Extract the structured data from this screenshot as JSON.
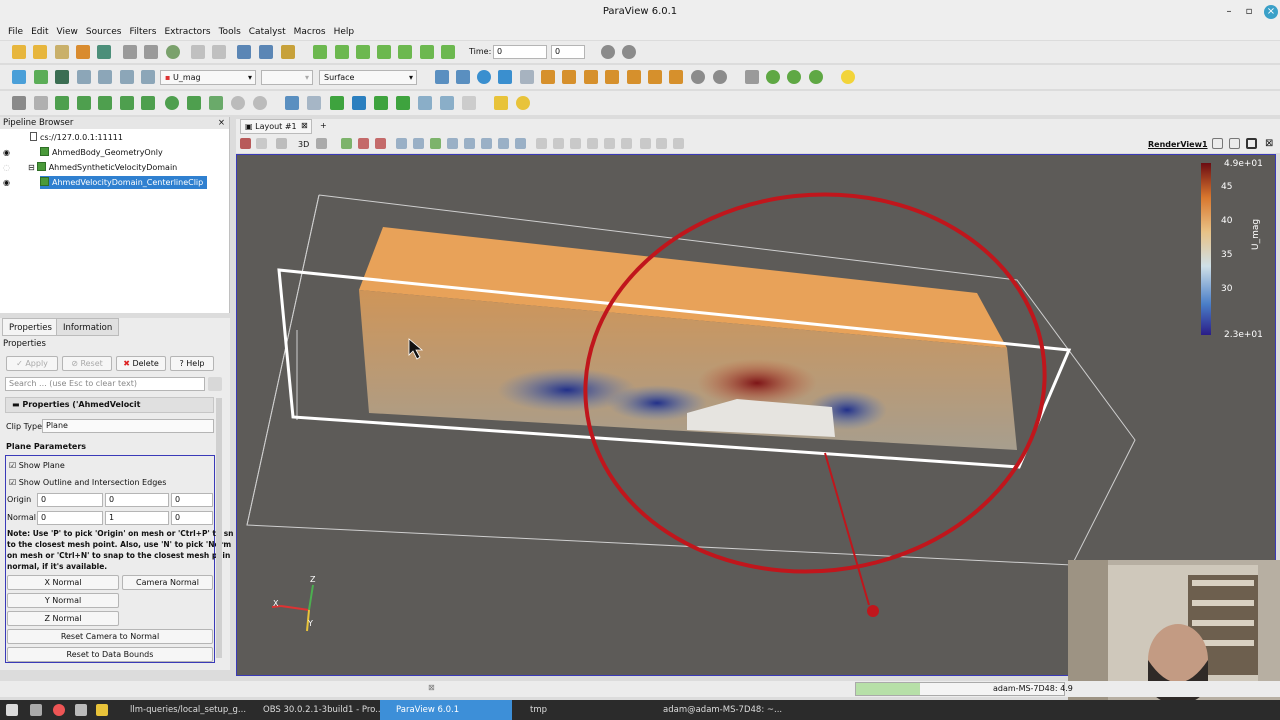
{
  "window": {
    "title": "ParaView 6.0.1"
  },
  "menu": [
    "File",
    "Edit",
    "View",
    "Sources",
    "Filters",
    "Extractors",
    "Tools",
    "Catalyst",
    "Macros",
    "Help"
  ],
  "time_toolbar": {
    "time_label": "Time:",
    "time_value": "0",
    "step_value": "0"
  },
  "display_toolbar": {
    "color_by": "U_mag",
    "representation": "Surface"
  },
  "pipeline": {
    "title": "Pipeline Browser",
    "server": "cs://127.0.0.1:11111",
    "items": [
      "AhmedBody_GeometryOnly",
      "AhmedSyntheticVelocityDomain",
      "AhmedVelocityDomain_CenterlineClip"
    ]
  },
  "properties": {
    "tabs": [
      "Properties",
      "Information"
    ],
    "title": "Properties",
    "apply": "Apply",
    "reset": "Reset",
    "delete": "Delete",
    "help": "Help",
    "search_placeholder": "Search ... (use Esc to clear text)",
    "section": "Properties ('AhmedVelocit",
    "clip_type_label": "Clip Type",
    "clip_type_value": "Plane",
    "plane_params": "Plane Parameters",
    "show_plane": "Show Plane",
    "show_outline": "Show Outline and Intersection Edges",
    "origin_label": "Origin",
    "origin": [
      "0",
      "0",
      "0"
    ],
    "normal_label": "Normal",
    "normal": [
      "0",
      "1",
      "0"
    ],
    "note1": "Note: Use 'P' to pick 'Origin' on mesh or 'Ctrl+P' to sn",
    "note2": "to the closest mesh point. Also, use 'N' to pick 'Norm",
    "note3": "on mesh or 'Ctrl+N' to snap to the closest mesh poin",
    "note4": "normal, if it's available.",
    "x_normal": "X Normal",
    "camera_normal": "Camera Normal",
    "y_normal": "Y Normal",
    "z_normal": "Z Normal",
    "reset_camera": "Reset Camera to Normal",
    "reset_bounds": "Reset to Data Bounds"
  },
  "layout": {
    "tab": "Layout #1",
    "add": "+",
    "view_name": "RenderView1"
  },
  "colorbar": {
    "title": "U_mag",
    "max": "4.9e+01",
    "min": "2.3e+01",
    "ticks": [
      "45",
      "40",
      "35",
      "30"
    ]
  },
  "axes": {
    "x": "X",
    "y": "Y",
    "z": "Z"
  },
  "status": {
    "host": "adam-MS-7D48: 4.9"
  },
  "taskbar": [
    "llm-queries/local_setup_g...",
    "OBS 30.0.2.1-3build1 - Pro...",
    "ParaView 6.0.1",
    "tmp",
    "adam@adam-MS-7D48: ~..."
  ]
}
